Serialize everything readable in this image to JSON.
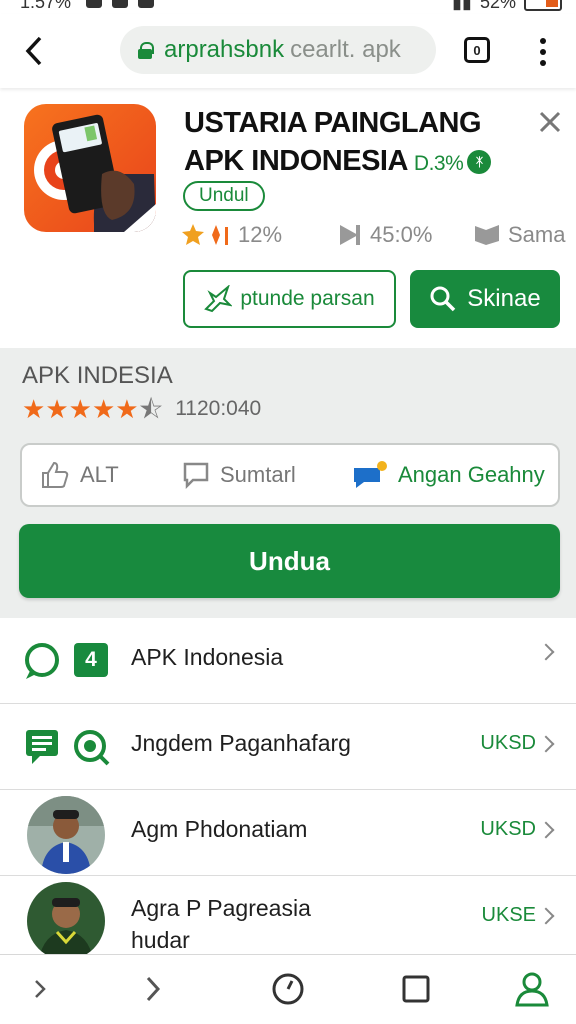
{
  "status": {
    "time": "1:57%",
    "battery": "52%"
  },
  "browser": {
    "url_domain": "arprahsbnk",
    "url_rest": "cearlt. apk",
    "tabs_count": "0"
  },
  "app": {
    "title": "USTARIA PAINGLANG APK INDONESIA",
    "version": "D.3%",
    "verified_mark": "ᛡ",
    "tag": "Undul",
    "stats": [
      {
        "value": "12%",
        "icon": "star-half-icon"
      },
      {
        "value": "45:0%",
        "icon": "play-icon"
      },
      {
        "value": "Sama",
        "icon": "flag-icon"
      }
    ],
    "secondary_button": "ptunde parsan",
    "primary_button": "Skinae"
  },
  "panel": {
    "title": "APK INDESIA",
    "rating_stars": 4.5,
    "rating_count": "1120:040",
    "actions": [
      {
        "label": "ALT",
        "icon": "thumbs-up-icon"
      },
      {
        "label": "Sumtarl",
        "icon": "comment-icon"
      },
      {
        "label": "Angan Geahny",
        "icon": "chat-bubble-icon"
      }
    ],
    "download_label": "Undua"
  },
  "list": [
    {
      "badge": "4",
      "text": "APK Indonesia",
      "action": ""
    },
    {
      "text": "Jngdem Paganhafarg",
      "action": "UKSD"
    },
    {
      "text": "Agm Phdonatiam",
      "action": "UKSD"
    },
    {
      "text": "Agra P Pagreasia hudar",
      "action": "UKSE"
    }
  ],
  "colors": {
    "accent": "#188a3e",
    "star": "#f06a1a",
    "icon_bg": "#f7731e"
  }
}
